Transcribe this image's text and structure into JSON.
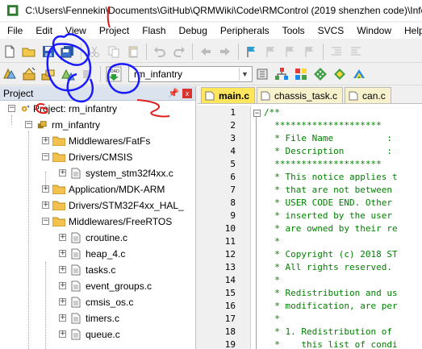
{
  "window": {
    "title": "C:\\Users\\Fennekin\\Documents\\GitHub\\QRMWiki\\Code\\RMControl (2019 shenzhen code)\\Info\\..."
  },
  "menu": [
    "File",
    "Edit",
    "View",
    "Project",
    "Flash",
    "Debug",
    "Peripherals",
    "Tools",
    "SVCS",
    "Window",
    "Help"
  ],
  "toolbar": {
    "target_name": "rm_infantry"
  },
  "project_panel": {
    "title": "Project",
    "close_label": "x",
    "tree": [
      {
        "label": "Project: rm_infantry",
        "kind": "project",
        "expanded": true
      },
      {
        "label": "rm_infantry",
        "kind": "target",
        "expanded": true
      },
      {
        "label": "Middlewares/FatFs",
        "kind": "folder",
        "expanded": false
      },
      {
        "label": "Drivers/CMSIS",
        "kind": "folder",
        "expanded": true
      },
      {
        "label": "system_stm32f4xx.c",
        "kind": "file",
        "expanded": false
      },
      {
        "label": "Application/MDK-ARM",
        "kind": "folder",
        "expanded": false
      },
      {
        "label": "Drivers/STM32F4xx_HAL_",
        "kind": "folder",
        "expanded": false
      },
      {
        "label": "Middlewares/FreeRTOS",
        "kind": "folder",
        "expanded": true
      },
      {
        "label": "croutine.c",
        "kind": "file"
      },
      {
        "label": "heap_4.c",
        "kind": "file"
      },
      {
        "label": "tasks.c",
        "kind": "file"
      },
      {
        "label": "event_groups.c",
        "kind": "file"
      },
      {
        "label": "cmsis_os.c",
        "kind": "file"
      },
      {
        "label": "timers.c",
        "kind": "file"
      },
      {
        "label": "queue.c",
        "kind": "file"
      }
    ]
  },
  "editor": {
    "tabs": [
      {
        "label": "main.c",
        "active": true
      },
      {
        "label": "chassis_task.c",
        "active": false
      },
      {
        "label": "can.c",
        "active": false
      }
    ],
    "lines": [
      {
        "n": "1",
        "text": "/**"
      },
      {
        "n": "2",
        "text": "  ********************"
      },
      {
        "n": "3",
        "text": "  * File Name          :"
      },
      {
        "n": "4",
        "text": "  * Description        :"
      },
      {
        "n": "5",
        "text": "  ********************"
      },
      {
        "n": "6",
        "text": "  * This notice applies t"
      },
      {
        "n": "7",
        "text": "  * that are not between"
      },
      {
        "n": "8",
        "text": "  * USER CODE END. Other"
      },
      {
        "n": "9",
        "text": "  * inserted by the user"
      },
      {
        "n": "10",
        "text": "  * are owned by their re"
      },
      {
        "n": "11",
        "text": "  *"
      },
      {
        "n": "12",
        "text": "  * Copyright (c) 2018 ST"
      },
      {
        "n": "13",
        "text": "  * All rights reserved."
      },
      {
        "n": "14",
        "text": "  *"
      },
      {
        "n": "15",
        "text": "  * Redistribution and us"
      },
      {
        "n": "16",
        "text": "  * modification, are per"
      },
      {
        "n": "17",
        "text": "  *"
      },
      {
        "n": "18",
        "text": "  * 1. Redistribution of"
      },
      {
        "n": "19",
        "text": "  *    this list of condi"
      }
    ]
  },
  "colors": {
    "annotation": "#1a1aff",
    "annotation_red": "#e11d1d",
    "comment": "#008000",
    "active_tab": "#ffe65c"
  }
}
